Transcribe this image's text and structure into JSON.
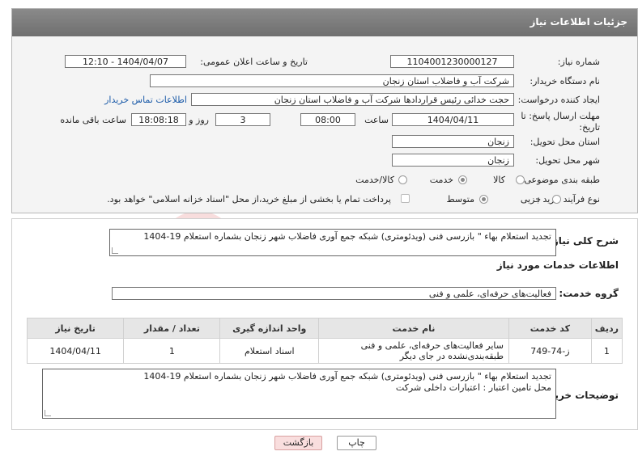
{
  "header": {
    "title": "جزئیات اطلاعات نیاز"
  },
  "form": {
    "need_number_label": "شماره نیاز:",
    "need_number": "1104001230000127",
    "announce_label": "تاریخ و ساعت اعلان عمومی:",
    "announce_value": "1404/04/07 - 12:10",
    "buyer_org_label": "نام دستگاه خریدار:",
    "buyer_org": "شرکت آب و فاضلاب استان زنجان",
    "creator_label": "ایجاد کننده درخواست:",
    "creator": "حجت  خدائی رئیس قراردادها شرکت آب و فاضلاب استان زنجان",
    "contact_link": "اطلاعات تماس خریدار",
    "deadline_label": "مهلت ارسال پاسخ: تا تاریخ:",
    "deadline_date": "1404/04/11",
    "time_label": "ساعت",
    "deadline_time": "08:00",
    "days_value": "3",
    "days_label": "روز و",
    "remaining_time": "18:08:18",
    "remaining_label": "ساعت باقی مانده",
    "province_label": "استان محل تحویل:",
    "province": "زنجان",
    "city_label": "شهر محل تحویل:",
    "city": "زنجان",
    "category_label": "طبقه بندی موضوعی:",
    "category_options": [
      "کالا",
      "خدمت",
      "کالا/خدمت"
    ],
    "process_label": "نوع فرآیند خرید :",
    "process_options": [
      "جزیی",
      "متوسط"
    ],
    "payment_note": "پرداخت تمام یا بخشی از مبلغ خرید،از محل \"اسناد خزانه اسلامی\" خواهد بود."
  },
  "details": {
    "summary_label": "شرح کلی نیاز:",
    "summary": "تجدید استعلام بهاء \" بازرسی فنی (ویدئومتری) شبکه جمع آوری فاضلاب شهر زنجان بشماره استعلام 19-1404",
    "services_title": "اطلاعات خدمات مورد نیاز",
    "group_label": "گروه خدمت:",
    "group": "فعالیت‌های حرفه‌ای، علمی و فنی",
    "columns": [
      "ردیف",
      "کد خدمت",
      "نام خدمت",
      "واحد اندازه گیری",
      "تعداد / مقدار",
      "تاریخ نیاز"
    ],
    "rows": [
      {
        "row": "1",
        "code": "ز-74-749",
        "name": "سایر فعالیت‌های حرفه‌ای، علمی و فنی طبقه‌بندی‌نشده در جای دیگر",
        "unit": "اسناد استعلام",
        "qty": "1",
        "date": "1404/04/11"
      }
    ],
    "buyer_notes_label": "توضیحات خریدار:",
    "buyer_notes_line1": "تجدید استعلام بهاء \" بازرسی فنی (ویدئومتری) شبکه جمع آوری فاضلاب شهر زنجان بشماره استعلام 19-1404",
    "buyer_notes_line2": "محل تامین اعتبار : اعتبارات داخلی شرکت"
  },
  "buttons": {
    "print": "چاپ",
    "back": "بازگشت"
  },
  "colors": {
    "header_bg": "#7d7d7d",
    "link": "#1a5aa8",
    "back_button_bg": "#f9dede"
  }
}
